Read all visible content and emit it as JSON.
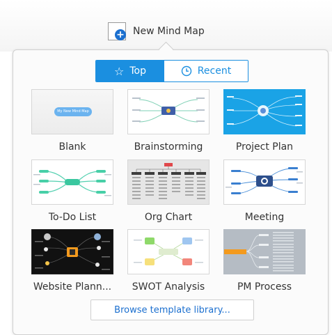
{
  "header": {
    "new_map_label": "New Mind Map",
    "new_map_icon": "plus-circle-icon"
  },
  "tabs": [
    {
      "label": "Top",
      "icon": "star-icon",
      "active": true
    },
    {
      "label": "Recent",
      "icon": "clock-icon",
      "active": false
    }
  ],
  "templates": [
    {
      "name": "Blank",
      "thumb_text": "My New Mind Map"
    },
    {
      "name": "Brainstorming"
    },
    {
      "name": "Project Plan"
    },
    {
      "name": "To-Do List"
    },
    {
      "name": "Org Chart"
    },
    {
      "name": "Meeting"
    },
    {
      "name": "Website Plann..."
    },
    {
      "name": "SWOT Analysis"
    },
    {
      "name": "PM Process"
    }
  ],
  "browse_label": "Browse template library...",
  "colors": {
    "accent": "#1b8fe0",
    "link": "#1b6fcf",
    "project_bg": "#1aa3e6",
    "website_bg": "#111111",
    "pm_bg": "#b5bcc4"
  }
}
